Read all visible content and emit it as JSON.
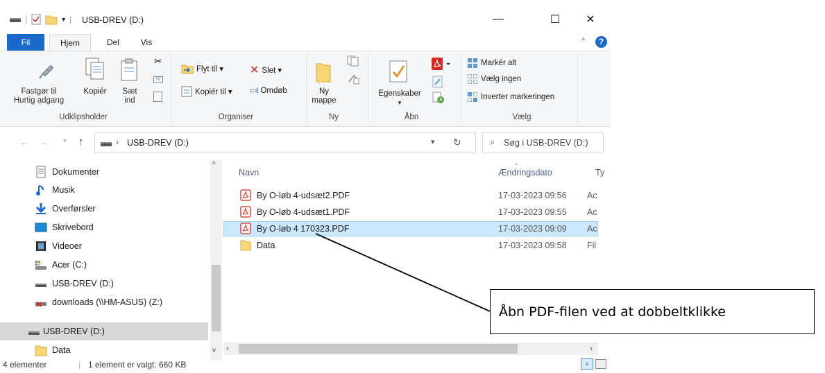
{
  "window": {
    "title": "USB-DREV (D:)",
    "minimize": "—",
    "maximize": "☐",
    "close": "✕"
  },
  "ribbon_tabs": [
    "Fil",
    "Hjem",
    "Del",
    "Vis"
  ],
  "ribbon": {
    "clipboard": {
      "pin_line1": "Fastgør til",
      "pin_line2": "Hurtig adgang",
      "copy": "Kopiér",
      "paste_line1": "Sæt",
      "paste_line2": "ind",
      "group": "Udklipsholder"
    },
    "organize": {
      "move_to": "Flyt til ▾",
      "copy_to": "Kopiér til ▾",
      "delete": "Slet ▾",
      "rename": "Omdøb",
      "group": "Organiser"
    },
    "new": {
      "new_folder_line1": "Ny",
      "new_folder_line2": "mappe",
      "group": "Ny"
    },
    "open": {
      "properties": "Egenskaber",
      "properties_arrow": "▾",
      "group": "Åbn"
    },
    "select": {
      "select_all": "Markér alt",
      "select_none": "Vælg ingen",
      "invert": "Inverter markeringen",
      "group": "Vælg"
    }
  },
  "address": {
    "path": "USB-DREV (D:)",
    "search_placeholder": "Søg i USB-DREV (D:)"
  },
  "nav": [
    {
      "label": "Dokumenter",
      "icon": "documents-icon"
    },
    {
      "label": "Musik",
      "icon": "music-icon"
    },
    {
      "label": "Overførsler",
      "icon": "downloads-icon"
    },
    {
      "label": "Skrivebord",
      "icon": "desktop-icon"
    },
    {
      "label": "Videoer",
      "icon": "videos-icon"
    },
    {
      "label": "Acer (C:)",
      "icon": "drive-c-icon"
    },
    {
      "label": "USB-DREV (D:)",
      "icon": "usb-drive-icon"
    },
    {
      "label": "downloads (\\\\HM-ASUS) (Z:)",
      "icon": "network-drive-icon"
    },
    {
      "label": "USB-DREV (D:)",
      "icon": "usb-drive-icon"
    },
    {
      "label": "Data",
      "icon": "folder-icon"
    }
  ],
  "columns": {
    "name": "Navn",
    "date": "Ændringsdato",
    "type": "Ty"
  },
  "files": [
    {
      "name": "By O-løb 4-udsæt2.PDF",
      "date": "17-03-2023 09:56",
      "type": "Ac"
    },
    {
      "name": "By O-løb 4-udsæt1.PDF",
      "date": "17-03-2023 09:55",
      "type": "Ac"
    },
    {
      "name": "By O-løb 4 170323.PDF",
      "date": "17-03-2023 09:09",
      "type": "Ac"
    },
    {
      "name": "Data",
      "date": "17-03-2023 09:58",
      "type": "Fil"
    }
  ],
  "status": {
    "count": "4 elementer",
    "selection": "1 element er valgt: 660 KB"
  },
  "callout": "Åbn PDF-filen ved at dobbeltklikke",
  "colors": {
    "accent": "#1b6ac9",
    "selection": "#cce8ff",
    "pdf_red": "#d9281e",
    "folder": "#f8d775"
  }
}
